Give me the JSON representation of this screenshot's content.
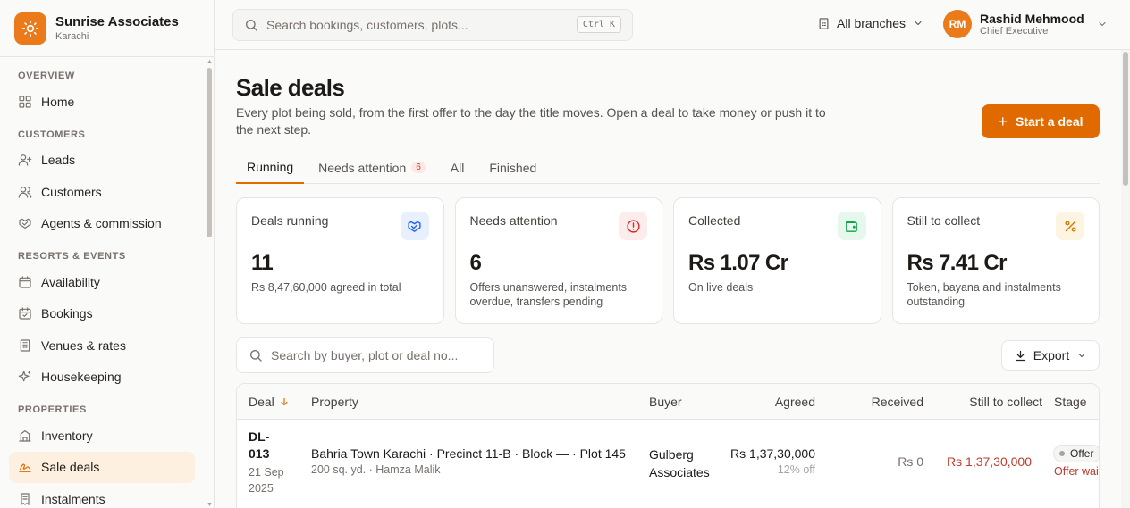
{
  "brand": {
    "name": "Sunrise Associates",
    "city": "Karachi"
  },
  "topbar": {
    "search_placeholder": "Search bookings, customers, plots...",
    "shortcut": "Ctrl K",
    "branch": "All branches",
    "user": {
      "initials": "RM",
      "name": "Rashid Mehmood",
      "role": "Chief Executive"
    }
  },
  "sidebar": {
    "sections": [
      {
        "title": "OVERVIEW",
        "items": [
          {
            "label": "Home",
            "icon": "grid-icon"
          }
        ]
      },
      {
        "title": "CUSTOMERS",
        "items": [
          {
            "label": "Leads",
            "icon": "user-plus-icon"
          },
          {
            "label": "Customers",
            "icon": "users-icon"
          },
          {
            "label": "Agents & commission",
            "icon": "handshake-icon"
          }
        ]
      },
      {
        "title": "RESORTS & EVENTS",
        "items": [
          {
            "label": "Availability",
            "icon": "calendar-icon"
          },
          {
            "label": "Bookings",
            "icon": "calendar-check-icon"
          },
          {
            "label": "Venues & rates",
            "icon": "building-icon"
          },
          {
            "label": "Housekeeping",
            "icon": "sparkles-icon"
          }
        ]
      },
      {
        "title": "PROPERTIES",
        "items": [
          {
            "label": "Inventory",
            "icon": "inventory-icon"
          },
          {
            "label": "Sale deals",
            "icon": "signature-icon",
            "active": true
          },
          {
            "label": "Instalments",
            "icon": "receipt-icon"
          }
        ]
      }
    ]
  },
  "page": {
    "title": "Sale deals",
    "subtitle": "Every plot being sold, from the first offer to the day the title moves. Open a deal to take money or push it to the next step.",
    "start_button": "Start a deal",
    "tabs": [
      {
        "label": "Running",
        "active": true
      },
      {
        "label": "Needs attention",
        "badge": "6"
      },
      {
        "label": "All"
      },
      {
        "label": "Finished"
      }
    ]
  },
  "cards": [
    {
      "label": "Deals running",
      "value": "11",
      "note": "Rs 8,47,60,000 agreed in total",
      "icon": "handshake-icon",
      "icon_bg": "#e8f0fe",
      "icon_color": "#2563eb"
    },
    {
      "label": "Needs attention",
      "value": "6",
      "note": "Offers unanswered, instalments overdue, transfers pending",
      "icon": "alert-circle-icon",
      "icon_bg": "#fdecec",
      "icon_color": "#dc2626"
    },
    {
      "label": "Collected",
      "value": "Rs 1.07 Cr",
      "note": "On live deals",
      "icon": "wallet-icon",
      "icon_bg": "#e6f7ee",
      "icon_color": "#16a34a"
    },
    {
      "label": "Still to collect",
      "value": "Rs 7.41 Cr",
      "note": "Token, bayana and instalments outstanding",
      "icon": "percent-icon",
      "icon_bg": "#fdf4e1",
      "icon_color": "#d97706"
    }
  ],
  "table": {
    "search_placeholder": "Search by buyer, plot or deal no...",
    "export_label": "Export",
    "columns": {
      "deal": "Deal",
      "property": "Property",
      "buyer": "Buyer",
      "agreed": "Agreed",
      "received": "Received",
      "still": "Still to collect",
      "stage": "Stage"
    },
    "rows": [
      {
        "deal_no_line1": "DL-",
        "deal_no_line2": "013",
        "date_line1": "21 Sep",
        "date_line2": "2025",
        "property": "Bahria Town Karachi · Precinct 11-B · Block — · Plot 145",
        "property_sub": "200 sq. yd. · Hamza Malik",
        "buyer_line1": "Gulberg",
        "buyer_line2": "Associates",
        "agreed": "Rs 1,37,30,000",
        "agreed_sub": "12% off",
        "received": "Rs 0",
        "still": "Rs 1,37,30,000",
        "stage": "Offer",
        "stage_sub": "Offer waiting"
      }
    ]
  },
  "colors": {
    "accent": "#e06a00",
    "danger": "#c0392b"
  }
}
